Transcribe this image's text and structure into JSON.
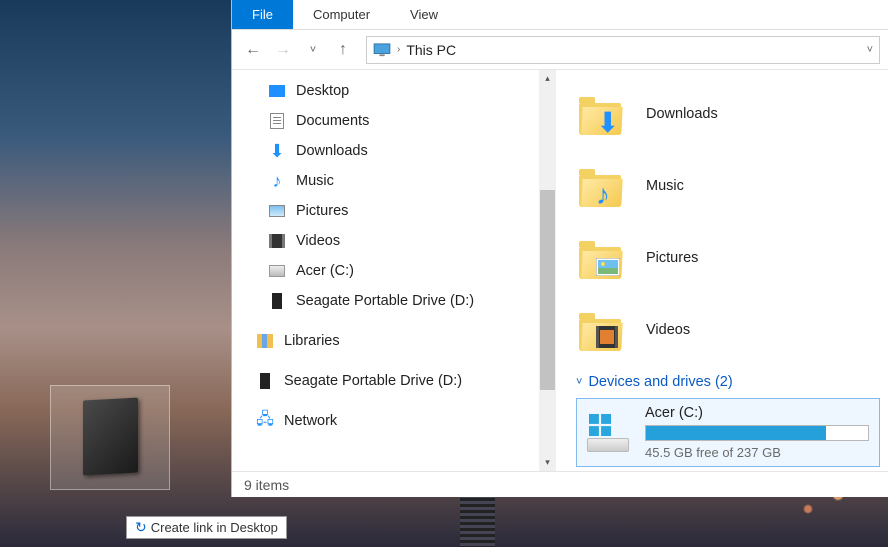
{
  "ribbon": {
    "tabs": [
      "File",
      "Computer",
      "View"
    ],
    "active_index": 0
  },
  "address": {
    "location": "This PC"
  },
  "tree": {
    "items": [
      {
        "label": "Desktop",
        "icon": "desktop",
        "level": 1
      },
      {
        "label": "Documents",
        "icon": "doc",
        "level": 1
      },
      {
        "label": "Downloads",
        "icon": "dl",
        "level": 1
      },
      {
        "label": "Music",
        "icon": "music",
        "level": 1
      },
      {
        "label": "Pictures",
        "icon": "pic",
        "level": 1
      },
      {
        "label": "Videos",
        "icon": "vid",
        "level": 1
      },
      {
        "label": "Acer (C:)",
        "icon": "hdd",
        "level": 1
      },
      {
        "label": "Seagate Portable Drive (D:)",
        "icon": "ext",
        "level": 1
      }
    ],
    "libraries": {
      "label": "Libraries"
    },
    "removable": {
      "label": "Seagate Portable Drive (D:)"
    },
    "network": {
      "label": "Network"
    }
  },
  "folders": [
    {
      "label": "Downloads",
      "overlay": "dl"
    },
    {
      "label": "Music",
      "overlay": "music"
    },
    {
      "label": "Pictures",
      "overlay": "pic"
    },
    {
      "label": "Videos",
      "overlay": "vid"
    }
  ],
  "group": {
    "header": "Devices and drives (2)"
  },
  "drive": {
    "name": "Acer (C:)",
    "free_text": "45.5 GB free of 237 GB",
    "fill_percent": 81
  },
  "status": {
    "text": "9 items"
  },
  "drag_tip": {
    "text": "Create link in Desktop"
  }
}
